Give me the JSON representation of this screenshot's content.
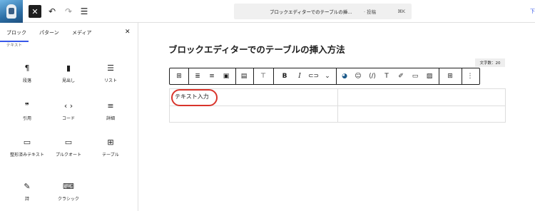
{
  "topbar": {
    "close_icon": "close-icon",
    "undo_icon": "undo-icon",
    "redo_icon": "redo-icon",
    "document_overview_icon": "list-view-icon",
    "command_title": "ブロックエディターでのテーブルの挿...",
    "command_type": "· 投稿",
    "command_shortcut": "⌘K",
    "right_link": "下"
  },
  "panel": {
    "tabs": [
      "ブロック",
      "パターン",
      "メディア"
    ],
    "active_tab": "ブロック",
    "section_title": "テキスト",
    "blocks": [
      {
        "label": "段落",
        "icon": "paragraph-icon"
      },
      {
        "label": "見出し",
        "icon": "heading-icon"
      },
      {
        "label": "リスト",
        "icon": "list-icon"
      },
      {
        "label": "引用",
        "icon": "quote-icon"
      },
      {
        "label": "コード",
        "icon": "code-icon"
      },
      {
        "label": "詳細",
        "icon": "details-icon"
      },
      {
        "label": "整形済みテキスト",
        "icon": "preformatted-icon"
      },
      {
        "label": "プルクオート",
        "icon": "pullquote-icon"
      },
      {
        "label": "テーブル",
        "icon": "table-icon"
      },
      {
        "label": "詩",
        "icon": "verse-icon"
      },
      {
        "label": "クラシック",
        "icon": "classic-icon"
      }
    ]
  },
  "editor": {
    "post_title": "ブロックエディターでのテーブルの挿入方法",
    "word_count": "文字数：20",
    "cell_text": "テキスト入力",
    "highlight_color": "#d9342b"
  }
}
